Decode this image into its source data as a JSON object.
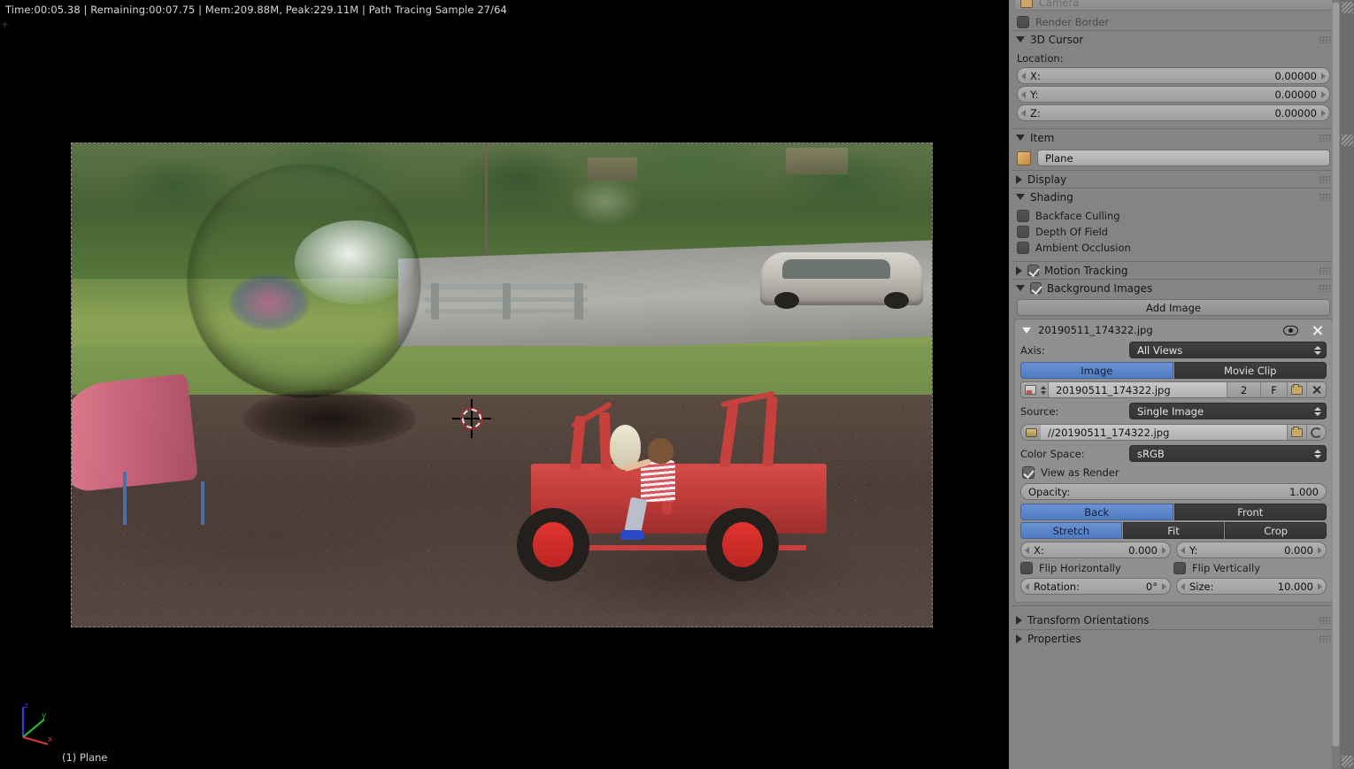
{
  "viewport": {
    "status_bar": "Time:00:05.38 | Remaining:00:07.75 | Mem:209.88M, Peak:229.11M | Path Tracing Sample 27/64",
    "object_label": "(1) Plane",
    "axis_labels": {
      "x": "x",
      "y": "y",
      "z": "z"
    },
    "axis_colors": {
      "x": "#d63b3b",
      "y": "#2fb02f",
      "z": "#3a3ad6"
    }
  },
  "sidebar": {
    "camera_row": {
      "label": "Camera"
    },
    "render_border": {
      "label": "Render Border",
      "checked": false
    },
    "cursor_panel": {
      "title": "3D Cursor",
      "expanded": true,
      "location_label": "Location:",
      "fields": [
        {
          "name": "X:",
          "value": "0.00000"
        },
        {
          "name": "Y:",
          "value": "0.00000"
        },
        {
          "name": "Z:",
          "value": "0.00000"
        }
      ]
    },
    "item_panel": {
      "title": "Item",
      "expanded": true,
      "object_name": "Plane"
    },
    "display_panel": {
      "title": "Display",
      "expanded": false
    },
    "shading_panel": {
      "title": "Shading",
      "expanded": true,
      "options": [
        {
          "label": "Backface Culling",
          "checked": false
        },
        {
          "label": "Depth Of Field",
          "checked": false
        },
        {
          "label": "Ambient Occlusion",
          "checked": false
        }
      ]
    },
    "motion_tracking_panel": {
      "title": "Motion Tracking",
      "expanded": false,
      "checked": true
    },
    "background_images_panel": {
      "title": "Background Images",
      "expanded": true,
      "checked": true,
      "add_image_label": "Add Image",
      "entry": {
        "name": "20190511_174322.jpg",
        "axis_label": "Axis:",
        "axis_value": "All Views",
        "source_type_options": [
          "Image",
          "Movie Clip"
        ],
        "source_type_active": "Image",
        "datablock_name": "20190511_174322.jpg",
        "datablock_users": "2",
        "datablock_fake_user": "F",
        "source_label": "Source:",
        "source_value": "Single Image",
        "filepath": "//20190511_174322.jpg",
        "color_space_label": "Color Space:",
        "color_space_value": "sRGB",
        "view_as_render": {
          "label": "View as Render",
          "checked": true
        },
        "opacity": {
          "name": "Opacity:",
          "value": "1.000"
        },
        "depth_options": [
          "Back",
          "Front"
        ],
        "depth_active": "Back",
        "frame_options": [
          "Stretch",
          "Fit",
          "Crop"
        ],
        "frame_active": "Stretch",
        "offset_x": {
          "name": "X:",
          "value": "0.000"
        },
        "offset_y": {
          "name": "Y:",
          "value": "0.000"
        },
        "flip_horizontally": {
          "label": "Flip Horizontally",
          "checked": false
        },
        "flip_vertically": {
          "label": "Flip Vertically",
          "checked": false
        },
        "rotation": {
          "name": "Rotation:",
          "value": "0°"
        },
        "size": {
          "name": "Size:",
          "value": "10.000"
        }
      }
    },
    "transform_orientations_panel": {
      "title": "Transform Orientations",
      "expanded": false
    },
    "properties_panel": {
      "title": "Properties",
      "expanded": false
    }
  },
  "colors": {
    "accent_blue": "#5680c2",
    "panel_bg": "#848484",
    "viewport_bg": "#000000",
    "field_light": "#b2b2b2",
    "field_dark": "#3a3a3a"
  }
}
